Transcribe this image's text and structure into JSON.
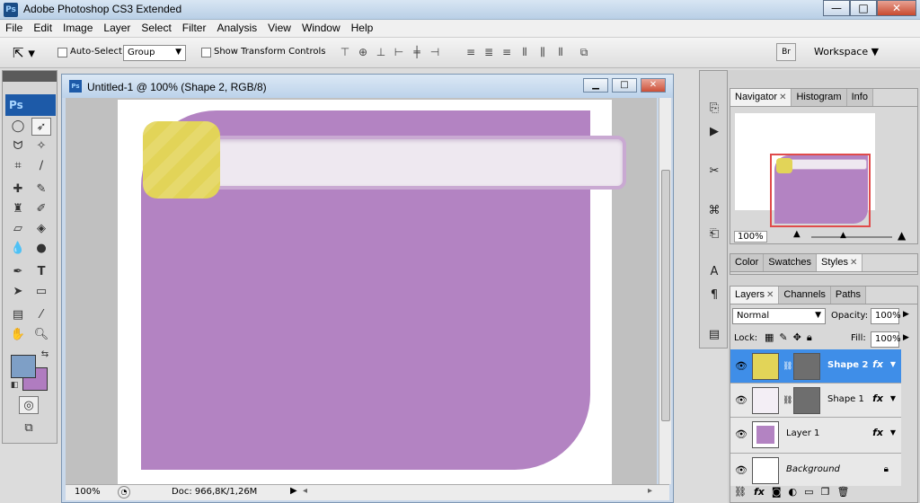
{
  "app": {
    "title": "Adobe Photoshop CS3 Extended",
    "logo": "Ps",
    "window_buttons": [
      "—",
      "□",
      "✕"
    ]
  },
  "menu": [
    "File",
    "Edit",
    "Image",
    "Layer",
    "Select",
    "Filter",
    "Analysis",
    "View",
    "Window",
    "Help"
  ],
  "options": {
    "auto_select_label": "Auto-Select:",
    "auto_select_value": "Group",
    "transform_label": "Show Transform Controls",
    "workspace_label": "Workspace"
  },
  "toolbox": {
    "logo": "Ps"
  },
  "document": {
    "title": "Untitled-1 @ 100% (Shape 2, RGB/8)",
    "zoom": "100%",
    "doc_info": "Doc: 966,8K/1,26M"
  },
  "navigator": {
    "tabs": [
      "Navigator",
      "Histogram",
      "Info"
    ],
    "zoom": "100%"
  },
  "styles_panel": {
    "tabs": [
      "Color",
      "Swatches",
      "Styles"
    ]
  },
  "layers_panel": {
    "tabs": [
      "Layers",
      "Channels",
      "Paths"
    ],
    "blend_mode": "Normal",
    "opacity_label": "Opacity:",
    "opacity_value": "100%",
    "lock_label": "Lock:",
    "fill_label": "Fill:",
    "fill_value": "100%",
    "layers": [
      {
        "name": "Shape 2",
        "selected": true,
        "fx": "fx"
      },
      {
        "name": "Shape 1",
        "selected": false,
        "fx": "fx"
      },
      {
        "name": "Layer 1",
        "selected": false,
        "fx": "fx"
      },
      {
        "name": "Background",
        "selected": false
      }
    ]
  },
  "colors": {
    "shape_purple": "#b383c2",
    "shape_yellow": "#e2d458",
    "foreground": "#7e9fc6",
    "background": "#b07cc0",
    "selection_blue": "#3f8ee8"
  }
}
